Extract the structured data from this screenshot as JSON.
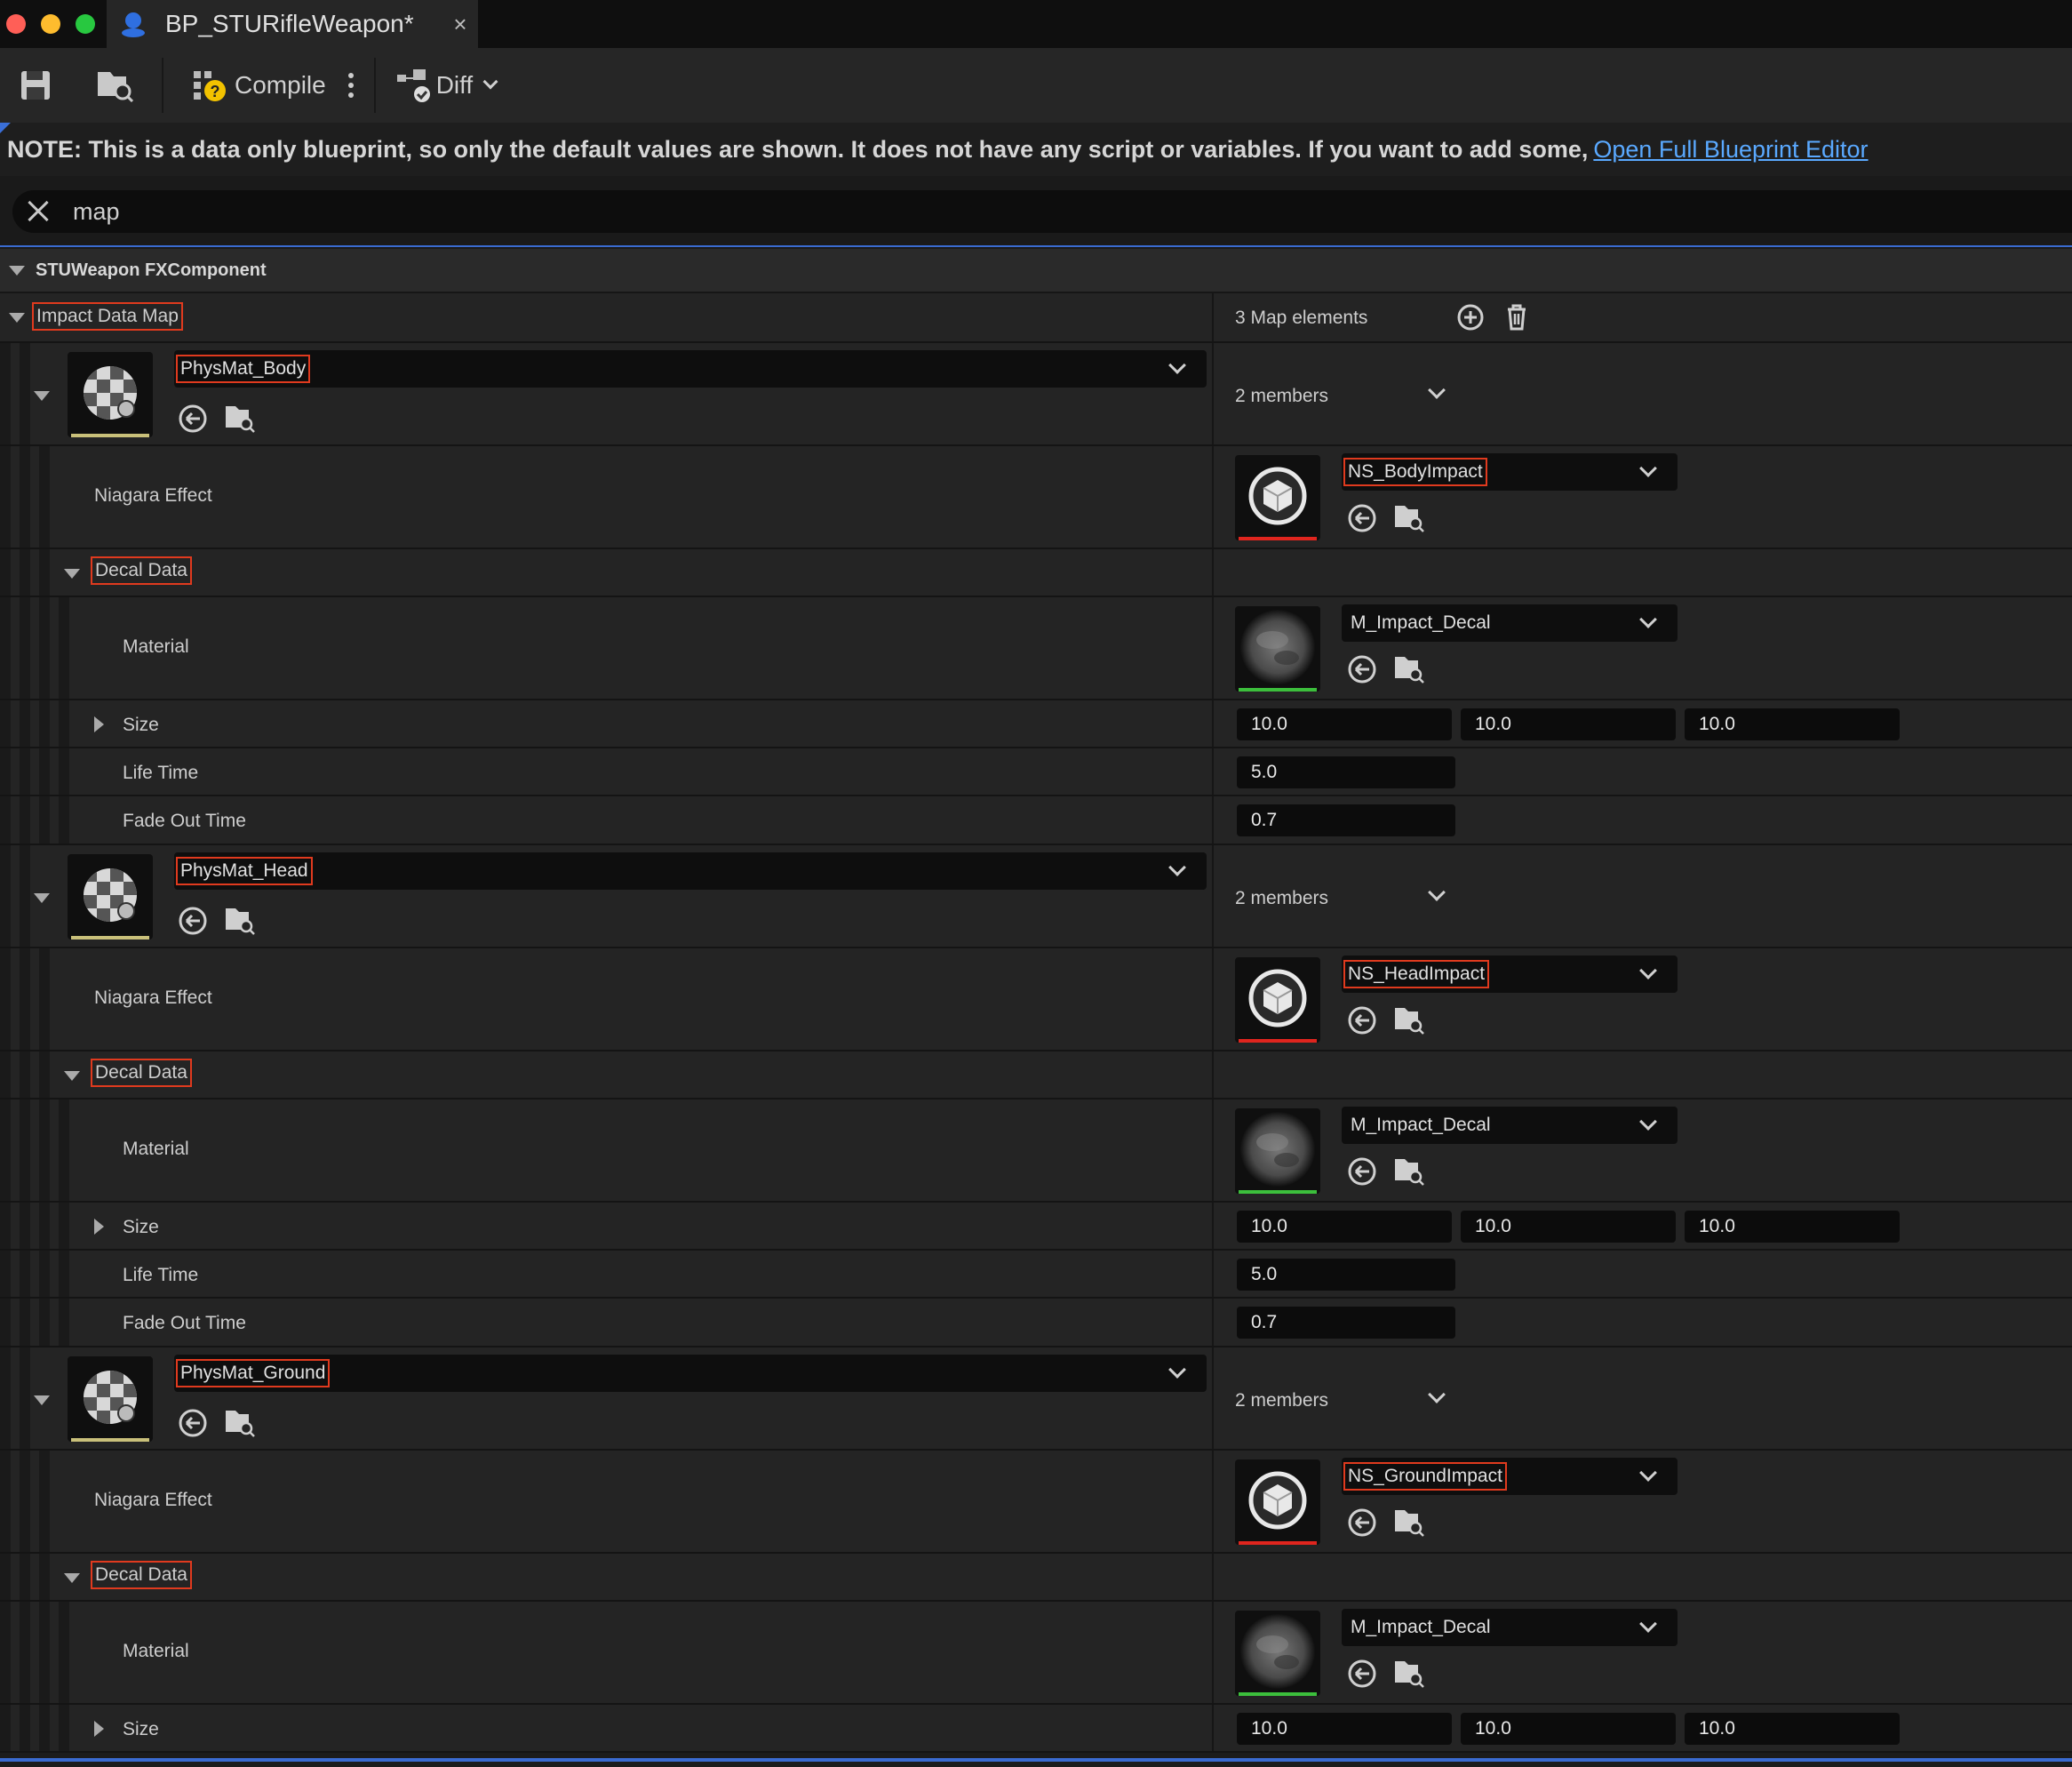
{
  "window": {
    "tab_title": "BP_STURifleWeapon*",
    "close_glyph": "×"
  },
  "toolbar": {
    "compile_label": "Compile",
    "diff_label": "Diff"
  },
  "note": {
    "text": "NOTE: This is a data only blueprint, so only the default values are shown.  It does not have any script or variables.  If you want to add some,",
    "link": "Open Full Blueprint Editor"
  },
  "search": {
    "value": "map"
  },
  "category": {
    "label": "STUWeapon FXComponent"
  },
  "map": {
    "label": "Impact Data Map",
    "count": "3 Map elements"
  },
  "labels": {
    "niagara": "Niagara Effect",
    "decal_data": "Decal Data",
    "material": "Material",
    "size": "Size",
    "life_time": "Life Time",
    "fade_out": "Fade Out Time",
    "members": "2 members"
  },
  "entries": [
    {
      "key": "PhysMat_Body",
      "niagara": "NS_BodyImpact",
      "material": "M_Impact_Decal",
      "size": [
        "10.0",
        "10.0",
        "10.0"
      ],
      "life_time": "5.0",
      "fade_out": "0.7"
    },
    {
      "key": "PhysMat_Head",
      "niagara": "NS_HeadImpact",
      "material": "M_Impact_Decal",
      "size": [
        "10.0",
        "10.0",
        "10.0"
      ],
      "life_time": "5.0",
      "fade_out": "0.7"
    },
    {
      "key": "PhysMat_Ground",
      "niagara": "NS_GroundImpact",
      "material": "M_Impact_Decal",
      "size": [
        "10.0",
        "10.0",
        "10.0"
      ]
    }
  ],
  "colors": {
    "accent": "#3a6bd1",
    "highlight_box": "#e03a1e",
    "link": "#5aa9ff",
    "niagara_bar": "#e0251e",
    "material_bar": "#3cbf3c",
    "physmat_bar": "#c9c07a"
  }
}
